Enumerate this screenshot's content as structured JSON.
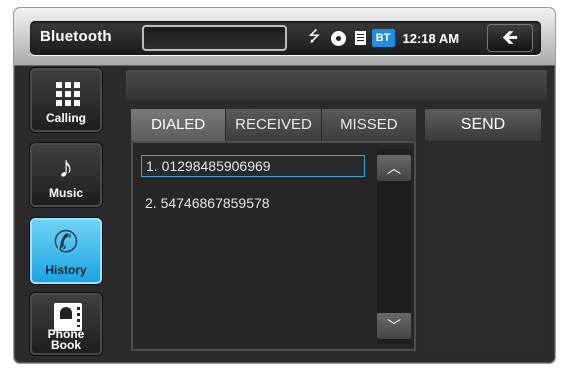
{
  "header": {
    "app_title": "Bluetooth",
    "bt_badge": "BT",
    "time": "12:18 AM",
    "icons": [
      "usb-icon",
      "disc-icon",
      "sd-card-icon",
      "bluetooth-badge-icon"
    ],
    "back_icon": "back-arrow-icon"
  },
  "sidebar": {
    "items": [
      {
        "label": "Calling",
        "icon": "keypad-icon",
        "active": false
      },
      {
        "label": "Music",
        "icon": "music-note-icon",
        "active": false
      },
      {
        "label": "History",
        "icon": "call-history-icon",
        "active": true
      },
      {
        "label": "Phone Book",
        "icon": "phonebook-icon",
        "active": false
      }
    ],
    "phonebook_line1": "Phone",
    "phonebook_line2": "Book"
  },
  "tabs": [
    {
      "label": "DIALED",
      "active": true
    },
    {
      "label": "RECEIVED",
      "active": false
    },
    {
      "label": "MISSED",
      "active": false
    }
  ],
  "send_label": "SEND",
  "history_list": [
    {
      "text": "1.  01298485906969",
      "selected": true
    },
    {
      "text": "2.  54746867859578",
      "selected": false
    }
  ],
  "colors": {
    "accent": "#1aa4e2",
    "selection_border": "#3da3d6",
    "bt_badge": "#1e8fe0"
  }
}
